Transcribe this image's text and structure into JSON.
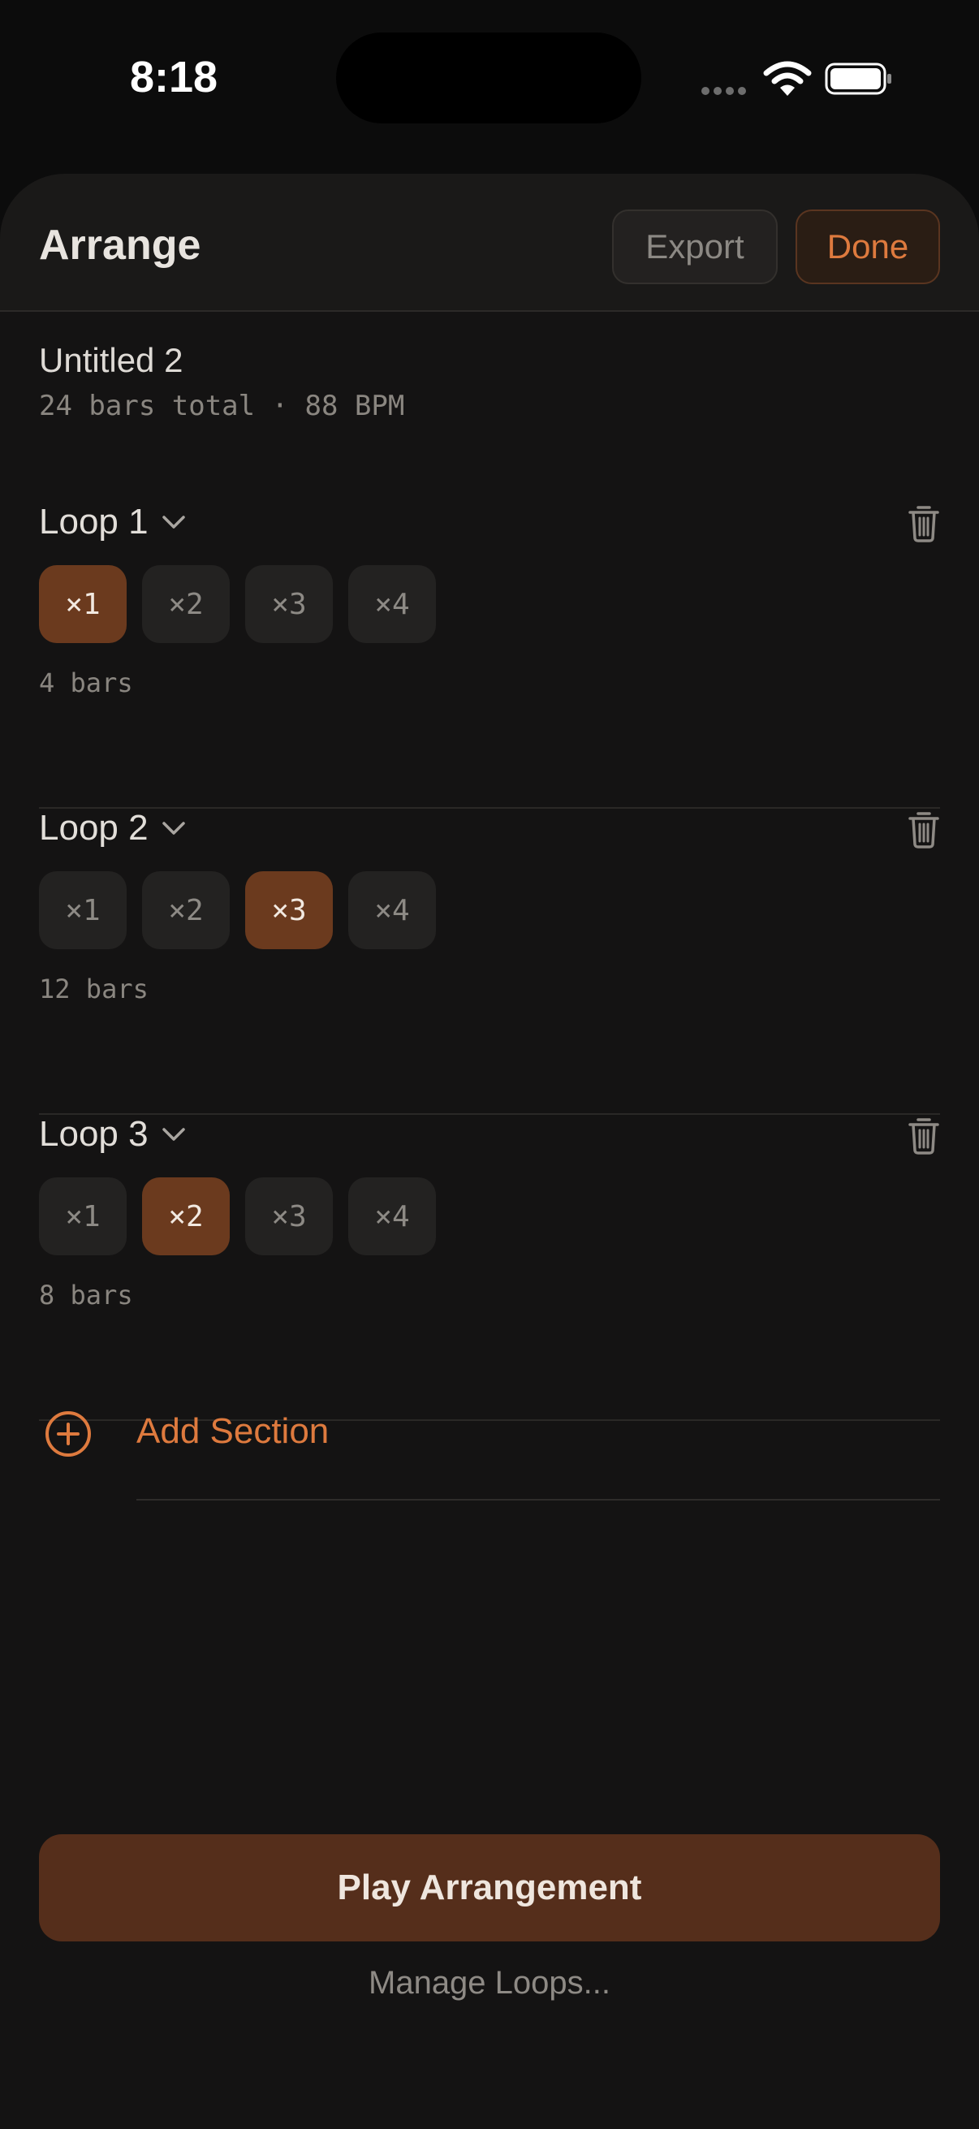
{
  "status_bar": {
    "time": "8:18"
  },
  "header": {
    "title": "Arrange",
    "export_label": "Export",
    "done_label": "Done"
  },
  "project": {
    "name": "Untitled 2",
    "meta": "24 bars total · 88 BPM"
  },
  "loops": [
    {
      "name": "Loop 1",
      "reps": [
        "×1",
        "×2",
        "×3",
        "×4"
      ],
      "selected_rep": "×1",
      "bars": "4 bars"
    },
    {
      "name": "Loop 2",
      "reps": [
        "×1",
        "×2",
        "×3",
        "×4"
      ],
      "selected_rep": "×3",
      "bars": "12 bars"
    },
    {
      "name": "Loop 3",
      "reps": [
        "×1",
        "×2",
        "×3",
        "×4"
      ],
      "selected_rep": "×2",
      "bars": "8 bars"
    }
  ],
  "add_section_label": "Add Section",
  "play_label": "Play Arrangement",
  "manage_label": "Manage Loops...",
  "colors": {
    "accent": "#de7a3e",
    "active_rep_bg": "#6b3a1e",
    "play_bg": "#552e1b",
    "background": "#141313"
  },
  "icons": {
    "loop_menu": "chevron-down-icon",
    "delete": "trash-icon",
    "add": "plus-circle-icon"
  }
}
